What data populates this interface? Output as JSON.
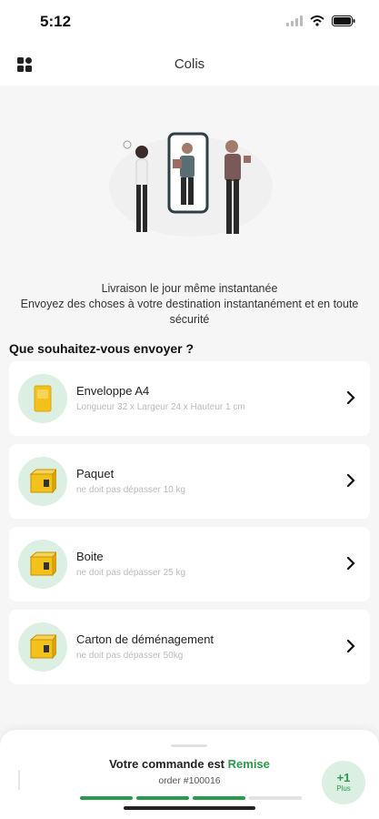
{
  "status_bar": {
    "time": "5:12",
    "icons": [
      "wifi-icon",
      "battery-icon"
    ]
  },
  "header": {
    "title": "Colis",
    "menu_icon": "grid-icon"
  },
  "promo": {
    "headline": "Livraison le jour même instantanée",
    "description": "Envoyez des choses à votre destination instantanément et en toute sécurité"
  },
  "section_title": "Que souhaitez-vous envoyer ?",
  "options": [
    {
      "title": "Enveloppe A4",
      "subtitle": "Longueur 32 x Largeur 24 x Hauteur 1 cm",
      "icon": "envelope-icon"
    },
    {
      "title": "Paquet",
      "subtitle": "ne doit pas dépasser 10 kg",
      "icon": "box-icon"
    },
    {
      "title": "Boite",
      "subtitle": "ne doit pas dépasser 25 kg",
      "icon": "box-icon"
    },
    {
      "title": "Carton de déménagement",
      "subtitle": "ne doit pas dépasser 50kg",
      "icon": "box-icon"
    }
  ],
  "order": {
    "status_prefix": "Votre commande est",
    "status_value": "Remise",
    "number": "order #100016",
    "progress_steps_total": 4,
    "progress_steps_done": 3,
    "more_count": "+1",
    "more_label": "Plus"
  },
  "colors": {
    "accent": "#2a9a4b",
    "icon_bg": "#dcefe3",
    "box": "#f2c21b"
  }
}
